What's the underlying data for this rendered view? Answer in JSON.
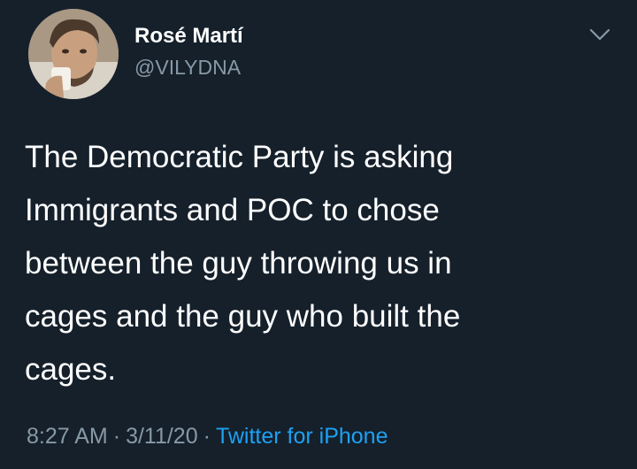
{
  "tweet": {
    "author": {
      "display_name": "Rosé Martí",
      "handle": "@VILYDNA"
    },
    "text_lines": [
      "The Democratic Party is asking",
      "Immigrants and POC to chose",
      "between the guy throwing us in",
      "cages and the guy who built the",
      "cages."
    ],
    "meta": {
      "time": "8:27 AM",
      "separator": "·",
      "date": "3/11/20",
      "source": "Twitter for iPhone"
    },
    "icons": {
      "menu": "chevron-down-icon"
    }
  },
  "colors": {
    "background": "#15202b",
    "primary_text": "#ffffff",
    "secondary_text": "#8899a6",
    "link": "#1da1f2"
  }
}
